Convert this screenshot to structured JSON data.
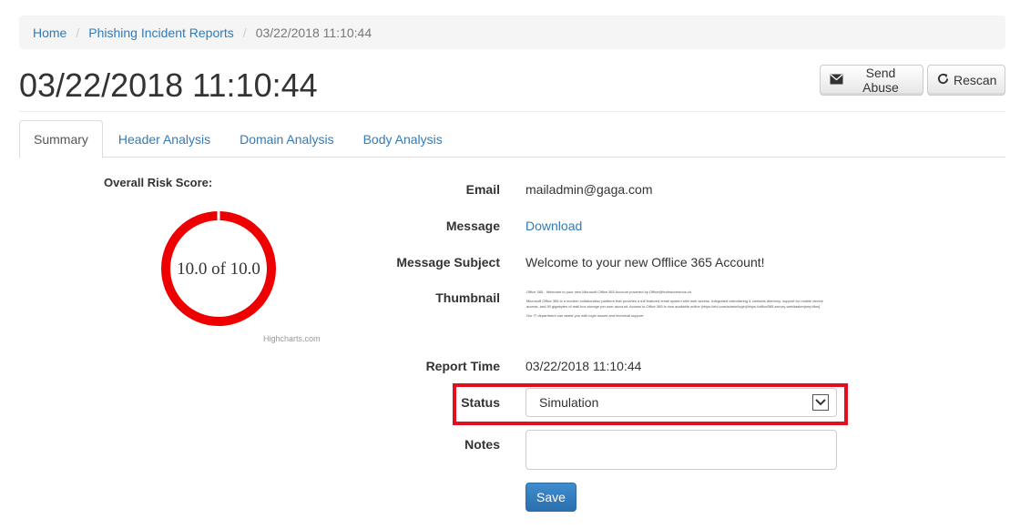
{
  "breadcrumb": {
    "home": "Home",
    "reports": "Phishing Incident Reports",
    "current": "03/22/2018 11:10:44"
  },
  "page": {
    "title": "03/22/2018 11:10:44",
    "send_abuse": "Send Abuse",
    "rescan": "Rescan"
  },
  "tabs": [
    {
      "label": "Summary",
      "active": true
    },
    {
      "label": "Header Analysis",
      "active": false
    },
    {
      "label": "Domain Analysis",
      "active": false
    },
    {
      "label": "Body Analysis",
      "active": false
    }
  ],
  "risk": {
    "label": "Overall Risk Score:",
    "score_text": "10.0 of 10.0",
    "score": 10.0,
    "max": 10.0,
    "gauge_color": "#ee0000",
    "credit": "Highcharts.com"
  },
  "details": {
    "email_label": "Email",
    "email_value": "mailadmin@gaga.com",
    "message_label": "Message",
    "message_link": "Download",
    "subject_label": "Message Subject",
    "subject_value": "Welcome to your new Offlice 365 Account!",
    "thumbnail_label": "Thumbnail",
    "thumbnail_lines": [
      "Office 365 - Welcome to your new Microsoft Office 365 Account powered by Office@feuhstorenmus.ch",
      "Microsoft Office 365 is a modern collaboration platform that provides a full featured email system with web access. Integrated calendaring & contacts directory, support for mobile device access, and 50 gigabytes of mail box storage per user account. Access to Office 365 is now available online (https://ebl.com/admin/login)/https://office365.secury-web/taskerjump4fus]",
      "Our IT department can assist you with login issues and technical support"
    ],
    "report_time_label": "Report Time",
    "report_time_value": "03/22/2018 11:10:44",
    "status_label": "Status",
    "status_value": "Simulation",
    "notes_label": "Notes",
    "notes_value": "",
    "save": "Save"
  },
  "colors": {
    "link": "#337ab7",
    "highlight": "#e0101e",
    "primary": "#337ab7"
  }
}
